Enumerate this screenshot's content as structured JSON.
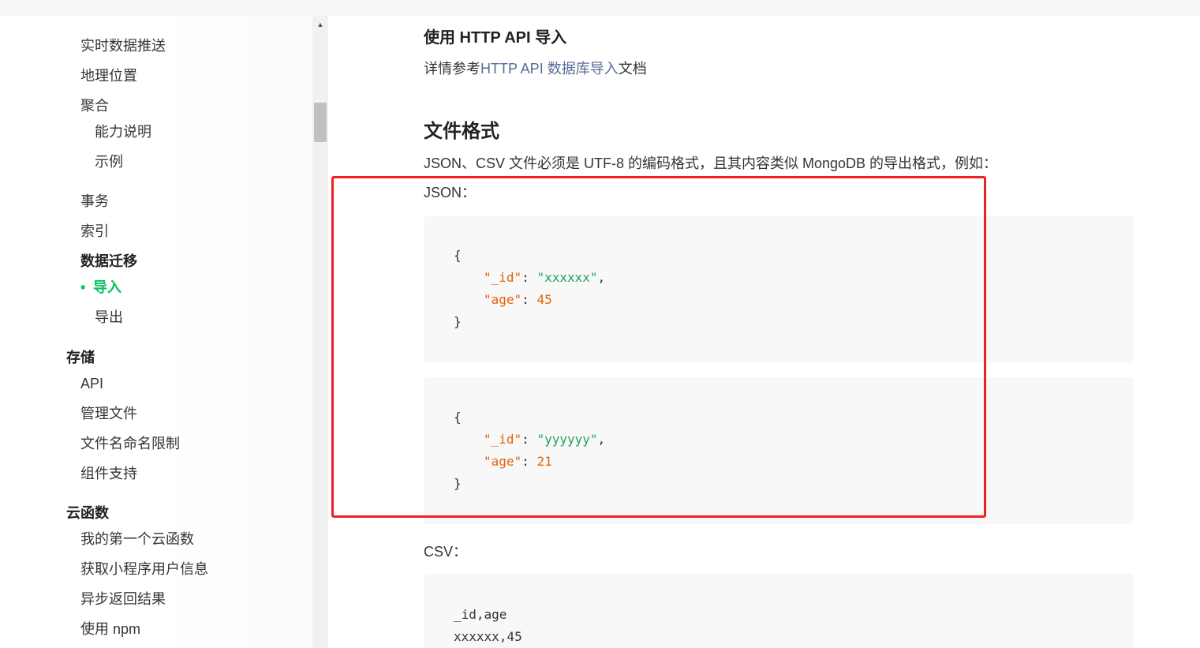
{
  "sidebar": {
    "items": [
      {
        "label": "实时数据推送"
      },
      {
        "label": "地理位置"
      },
      {
        "label": "聚合"
      },
      {
        "label": "能力说明"
      },
      {
        "label": "示例"
      },
      {
        "label": "事务"
      },
      {
        "label": "索引"
      },
      {
        "label": "数据迁移"
      },
      {
        "label": "导入"
      },
      {
        "label": "导出"
      },
      {
        "label": "存储"
      },
      {
        "label": "API"
      },
      {
        "label": "管理文件"
      },
      {
        "label": "文件名命名限制"
      },
      {
        "label": "组件支持"
      },
      {
        "label": "云函数"
      },
      {
        "label": "我的第一个云函数"
      },
      {
        "label": "获取小程序用户信息"
      },
      {
        "label": "异步返回结果"
      },
      {
        "label": "使用 npm"
      }
    ],
    "active_bullet": "•"
  },
  "main": {
    "http_heading": "使用 HTTP API 导入",
    "http_desc_prefix": "详情参考",
    "http_desc_link": "HTTP API 数据库导入",
    "http_desc_suffix": "文档",
    "format_heading": "文件格式",
    "format_desc": "JSON、CSV 文件必须是 UTF-8 的编码格式，且其内容类似 MongoDB 的导出格式，例如：",
    "json_label": "JSON：",
    "json_records": [
      {
        "id_key": "\"_id\"",
        "id_value": "\"xxxxxx\"",
        "age_key": "\"age\"",
        "age_value": "45"
      },
      {
        "id_key": "\"_id\"",
        "id_value": "\"yyyyyy\"",
        "age_key": "\"age\"",
        "age_value": "21"
      }
    ],
    "brace_open": "{",
    "brace_close": "}",
    "colon": ": ",
    "comma": ",",
    "csv_label": "CSV：",
    "csv_lines": [
      "_id,age",
      "xxxxxx,45"
    ]
  },
  "colors": {
    "active": "#07c160",
    "link": "#576b95",
    "json_key": "#e36209",
    "json_string": "#22a35a",
    "highlight_border": "#ee2222"
  }
}
